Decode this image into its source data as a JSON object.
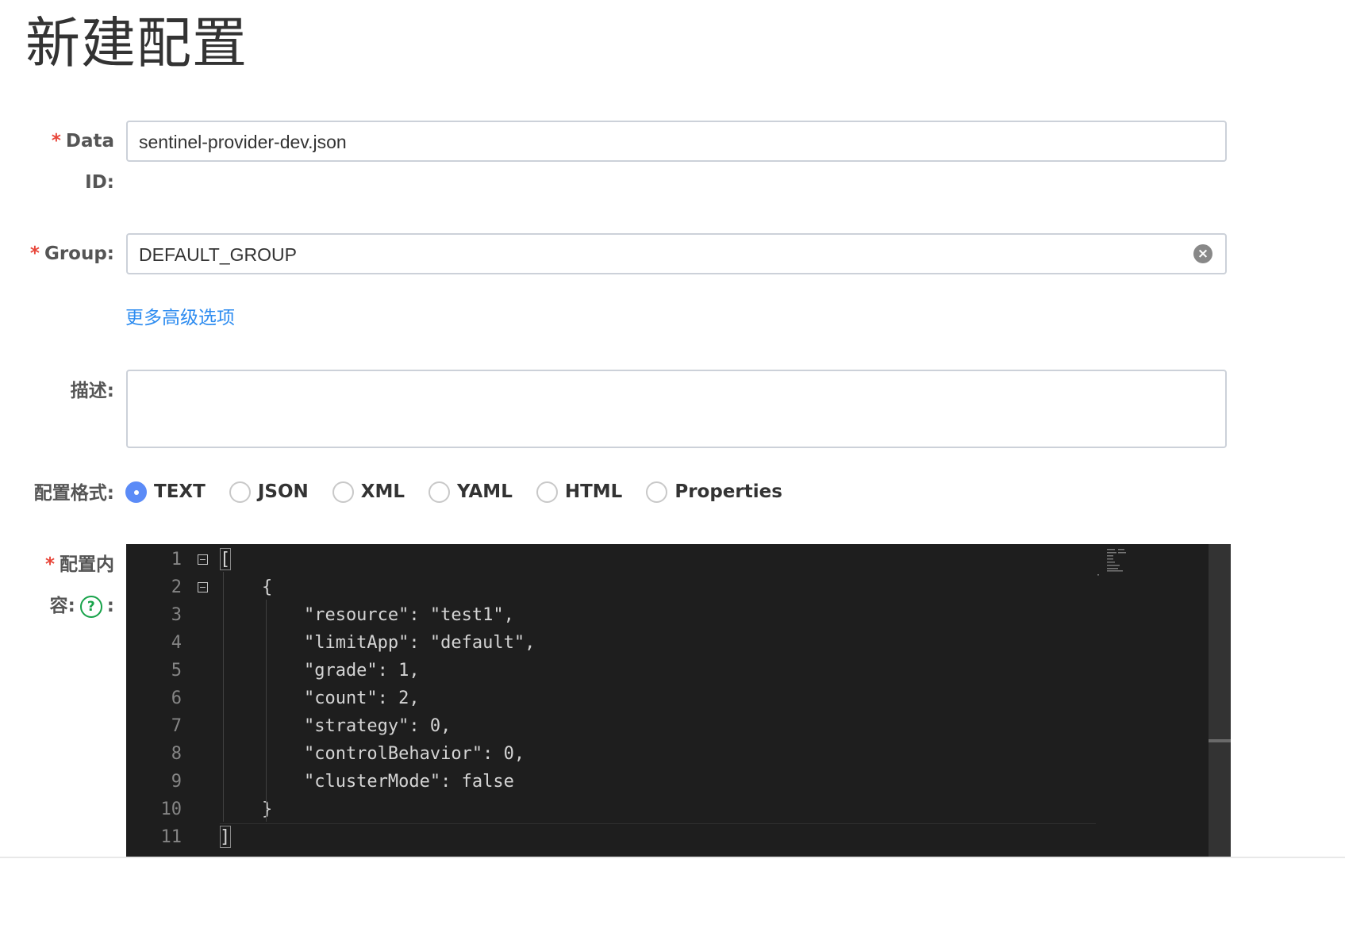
{
  "page": {
    "title": "新建配置"
  },
  "form": {
    "data_id": {
      "label_line1": "Data",
      "label_line2": "ID:",
      "value": "sentinel-provider-dev.json"
    },
    "group": {
      "label": "Group:",
      "value": "DEFAULT_GROUP",
      "clear_icon": "circle-x-icon"
    },
    "advanced_link": "更多高级选项",
    "description": {
      "label": "描述:",
      "value": ""
    },
    "format": {
      "label": "配置格式:",
      "options": [
        "TEXT",
        "JSON",
        "XML",
        "YAML",
        "HTML",
        "Properties"
      ],
      "selected": "TEXT"
    },
    "content": {
      "label_line1": "配置内",
      "label_line2_prefix": "容:",
      "label_line2_suffix": ":",
      "help_icon": "question-circle-icon"
    },
    "required_marker": "*"
  },
  "editor": {
    "lines": [
      {
        "num": "1",
        "text": "["
      },
      {
        "num": "2",
        "text": "    {"
      },
      {
        "num": "3",
        "text": "        \"resource\": \"test1\","
      },
      {
        "num": "4",
        "text": "        \"limitApp\": \"default\","
      },
      {
        "num": "5",
        "text": "        \"grade\": 1,"
      },
      {
        "num": "6",
        "text": "        \"count\": 2,"
      },
      {
        "num": "7",
        "text": "        \"strategy\": 0,"
      },
      {
        "num": "8",
        "text": "        \"controlBehavior\": 0,"
      },
      {
        "num": "9",
        "text": "        \"clusterMode\": false"
      },
      {
        "num": "10",
        "text": "    }"
      },
      {
        "num": "11",
        "text": "]"
      }
    ],
    "fold_symbol": "−",
    "colors": {
      "background": "#1e1e1e",
      "text": "#d4d4d4",
      "gutter": "#858585"
    }
  },
  "colors": {
    "accent": "#5b8bf7",
    "link": "#2d8cf0",
    "required": "#e8463a",
    "help": "#18a34a"
  }
}
